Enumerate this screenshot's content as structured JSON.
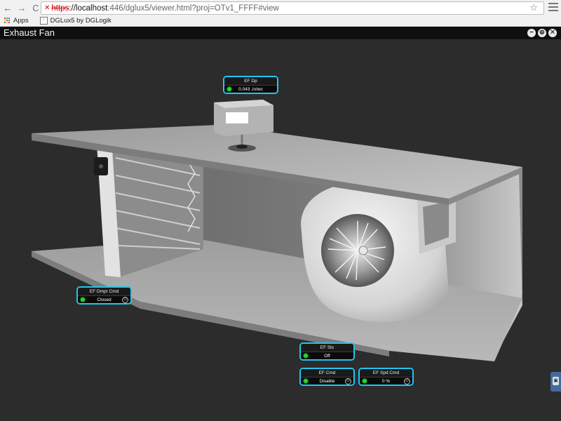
{
  "browser": {
    "url_protocol": "https",
    "url_host": "localhost",
    "url_rest": ":446/dglux5/viewer.html?proj=OTv1_FFFF#view",
    "bookmarks": [
      "Apps",
      "DGLux5 by DGLogik"
    ]
  },
  "app": {
    "title": "Exhaust Fan",
    "window_controls": [
      "−",
      "⊕",
      "✕"
    ]
  },
  "widgets": {
    "ef_dp": {
      "title": "EF Dp",
      "value": "0.043 ,in/wc"
    },
    "ef_dmpr_cmd": {
      "title": "EF Dmpr Cmd",
      "value": "Closed"
    },
    "ef_sts": {
      "title": "EF Sts",
      "value": "Off"
    },
    "ef_cmd": {
      "title": "EF Cmd",
      "value": "Disable"
    },
    "ef_spd_cmd": {
      "title": "EF Spd Cmd",
      "value": "0 %"
    }
  },
  "colors": {
    "accent_border": "#1fc7ef",
    "status_led": "#26d62a"
  }
}
